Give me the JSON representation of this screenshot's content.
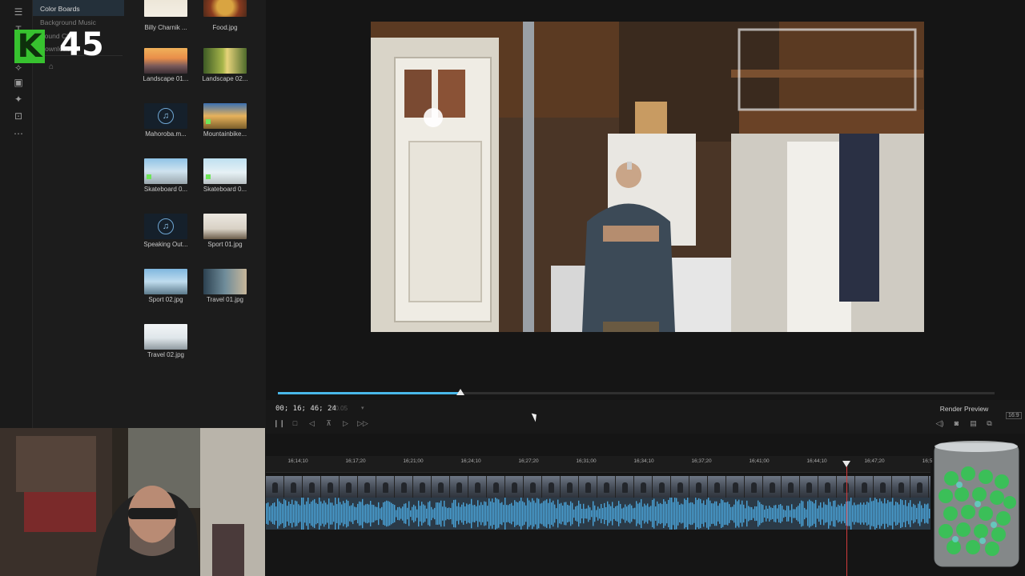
{
  "tree": {
    "items": [
      {
        "label": "Color Boards"
      },
      {
        "label": "Background Music"
      },
      {
        "label": "Sound Clips"
      },
      {
        "label": "Downloaded"
      }
    ]
  },
  "rail_icons": [
    "menu-icon",
    "text-icon",
    "transition-icon",
    "effect-icon",
    "pip-icon",
    "particle-icon",
    "title-icon",
    "more-icon"
  ],
  "media": {
    "tiles": [
      {
        "name": "Billy Charnik ..."
      },
      {
        "name": "Food.jpg"
      },
      {
        "name": "Landscape 01..."
      },
      {
        "name": "Landscape 02..."
      },
      {
        "name": "Mahoroba.m..."
      },
      {
        "name": "Mountainbike..."
      },
      {
        "name": "Skateboard 0..."
      },
      {
        "name": "Skateboard 0..."
      },
      {
        "name": "Speaking Out..."
      },
      {
        "name": "Sport 01.jpg"
      },
      {
        "name": "Sport 02.jpg"
      },
      {
        "name": "Travel 01.jpg"
      },
      {
        "name": "Travel 02.jpg"
      }
    ]
  },
  "overlay": {
    "logo_letter": "K",
    "logo_number": "45"
  },
  "player": {
    "timecode": "00; 16; 46; 24",
    "fps": "I 0.05",
    "progress": 0.255,
    "render_preview": "Render Preview",
    "aspect_ratio": "16:9"
  },
  "timeline": {
    "ticks": [
      "16;14;10",
      "16;17;20",
      "16;21;00",
      "16;24;10",
      "16;27;20",
      "16;31;00",
      "16;34;10",
      "16;37;20",
      "16;41;00",
      "16;44;10",
      "16;47;20",
      "16;5"
    ]
  },
  "colors": {
    "accent": "#49b7e8",
    "playhead": "#d23b3b",
    "audio_wave": "#4aa3d8",
    "logo_green": "#37c22f"
  }
}
